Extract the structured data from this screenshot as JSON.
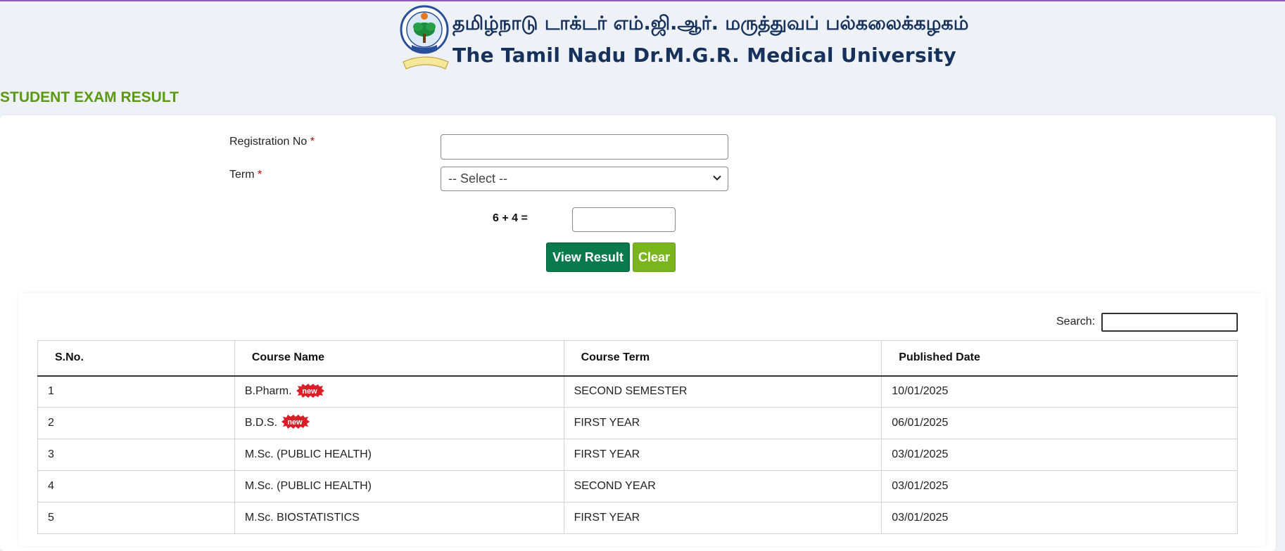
{
  "header": {
    "title_tamil": "தமிழ்நாடு டாக்டர் எம்.ஜி.ஆர். மருத்துவப் பல்கலைக்கழகம்",
    "title_english": "The Tamil Nadu Dr.M.G.R. Medical University",
    "seal_icon": "university-seal-icon"
  },
  "page": {
    "heading": "STUDENT EXAM RESULT"
  },
  "form": {
    "registration_label": "Registration No",
    "registration_value": "",
    "term_label": "Term",
    "required_mark": "*",
    "term_selected": "-- Select --",
    "captcha_question": "6 + 4 =",
    "captcha_value": "",
    "view_result_label": "View Result",
    "clear_label": "Clear"
  },
  "search": {
    "label": "Search:",
    "value": ""
  },
  "table": {
    "headers": [
      "S.No.",
      "Course Name",
      "Course Term",
      "Published Date"
    ],
    "new_badge_text": "new",
    "rows": [
      {
        "sno": "1",
        "course": "B.Pharm.",
        "is_new": true,
        "term": "SECOND SEMESTER",
        "date": "10/01/2025"
      },
      {
        "sno": "2",
        "course": "B.D.S.",
        "is_new": true,
        "term": "FIRST YEAR",
        "date": "06/01/2025"
      },
      {
        "sno": "3",
        "course": "M.Sc. (PUBLIC HEALTH)",
        "is_new": false,
        "term": "FIRST YEAR",
        "date": "03/01/2025"
      },
      {
        "sno": "4",
        "course": "M.Sc. (PUBLIC HEALTH)",
        "is_new": false,
        "term": "SECOND YEAR",
        "date": "03/01/2025"
      },
      {
        "sno": "5",
        "course": "M.Sc. BIOSTATISTICS",
        "is_new": false,
        "term": "FIRST YEAR",
        "date": "03/01/2025"
      }
    ]
  },
  "colors": {
    "top_line": "#8e5bb5",
    "heading_green": "#5a9a12",
    "view_button": "#0a7a4e",
    "clear_button": "#7ab51d",
    "title_navy": "#16325c",
    "badge_red": "#d61f26"
  }
}
